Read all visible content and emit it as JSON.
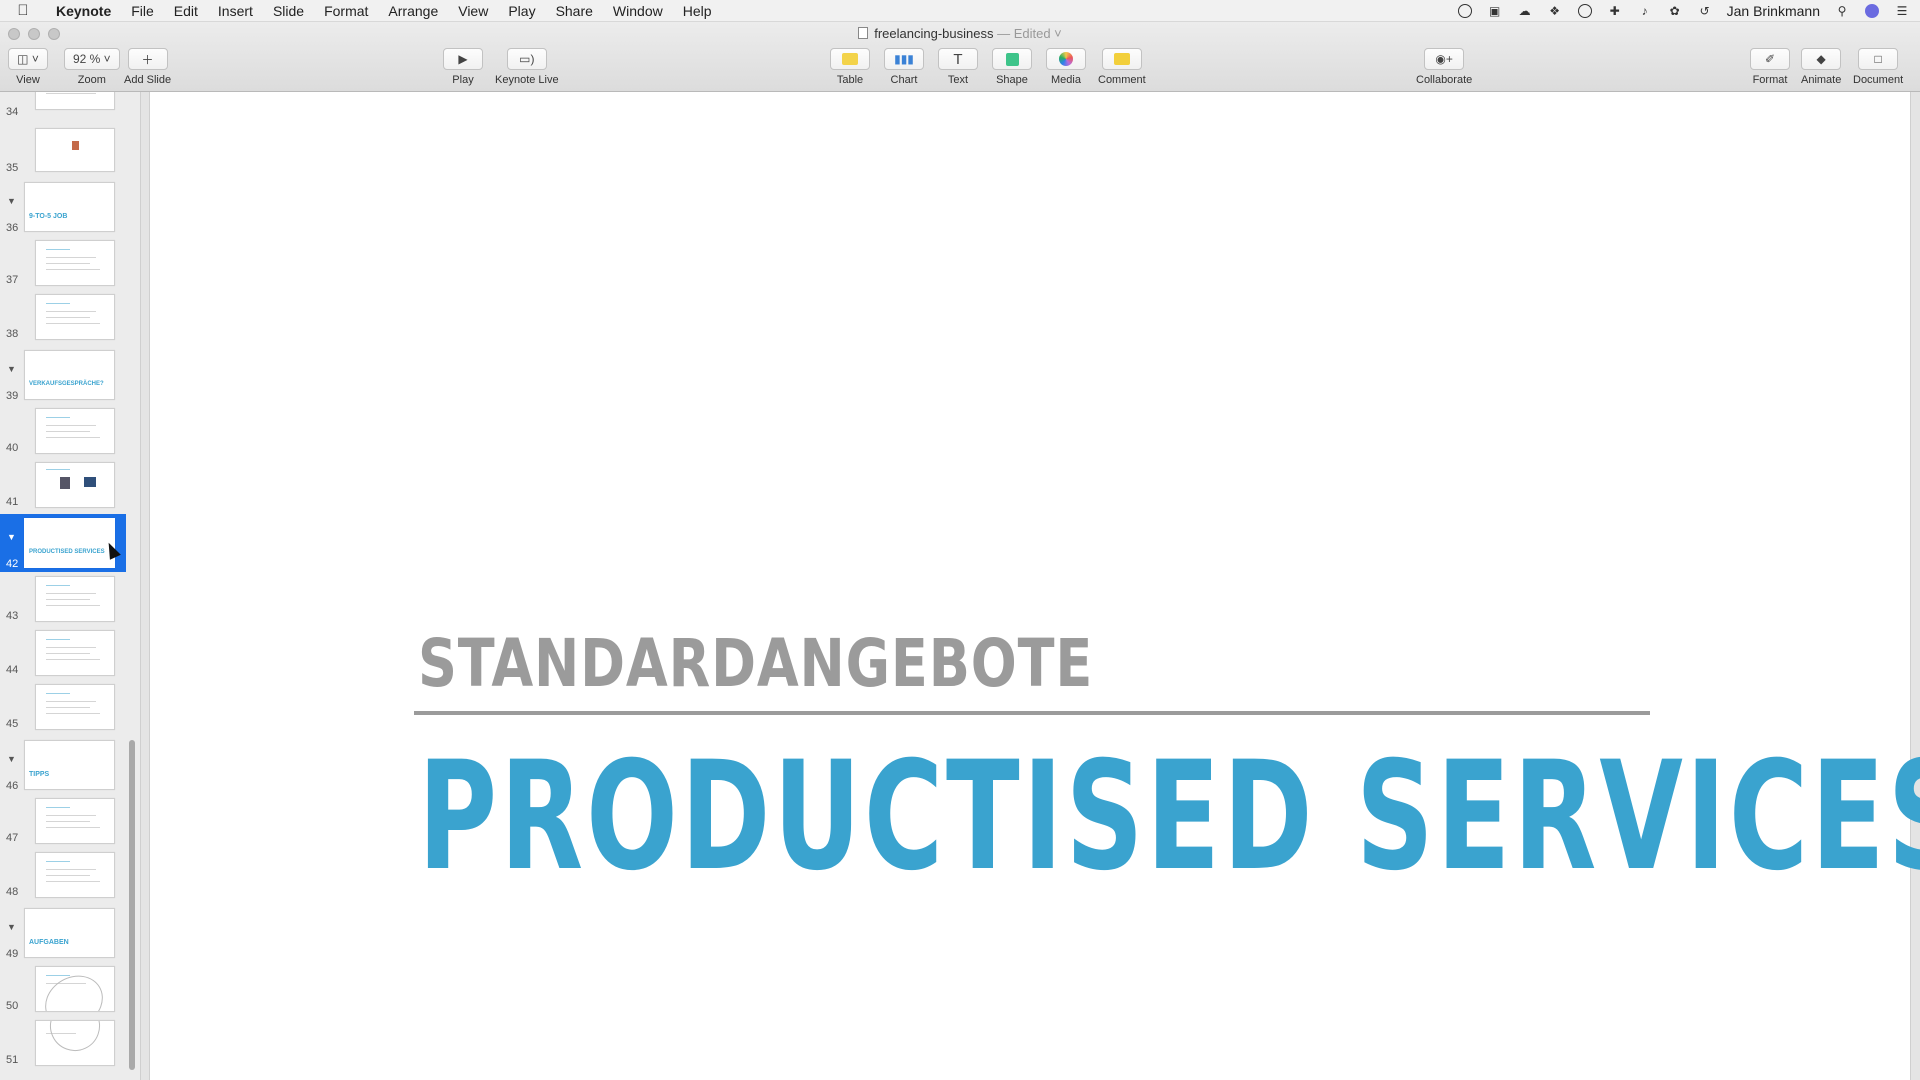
{
  "menubar": {
    "app_name": "Keynote",
    "items": [
      "File",
      "Edit",
      "Insert",
      "Slide",
      "Format",
      "Arrange",
      "View",
      "Play",
      "Share",
      "Window",
      "Help"
    ],
    "user": "Jan Brinkmann"
  },
  "window": {
    "doc_name": "freelancing-business",
    "edited": "— Edited ˅"
  },
  "toolbar": {
    "view_label": "View",
    "zoom_value": "92 % ˅",
    "zoom_label": "Zoom",
    "add_slide_label": "Add Slide",
    "play_label": "Play",
    "keynote_live_label": "Keynote Live",
    "table_label": "Table",
    "chart_label": "Chart",
    "text_label": "Text",
    "shape_label": "Shape",
    "media_label": "Media",
    "comment_label": "Comment",
    "collaborate_label": "Collaborate",
    "format_label": "Format",
    "animate_label": "Animate",
    "document_label": "Document",
    "colors": {
      "table": "#f3d34a",
      "chart": "#3b82d6",
      "shape": "#3ec48a",
      "comment": "#f2cf3b"
    }
  },
  "navigator": {
    "slides": [
      {
        "num": "34"
      },
      {
        "num": "35"
      },
      {
        "num": "36",
        "title": "9-TO-5 JOB"
      },
      {
        "num": "37"
      },
      {
        "num": "38"
      },
      {
        "num": "39",
        "title": "VERKAUFSGESPRÄCHE?"
      },
      {
        "num": "40"
      },
      {
        "num": "41"
      },
      {
        "num": "42",
        "title": "PRODUCTISED SERVICES",
        "selected": true
      },
      {
        "num": "43"
      },
      {
        "num": "44"
      },
      {
        "num": "45"
      },
      {
        "num": "46",
        "title": "TIPPS"
      },
      {
        "num": "47"
      },
      {
        "num": "48"
      },
      {
        "num": "49",
        "title": "AUFGABEN"
      },
      {
        "num": "50"
      },
      {
        "num": "51"
      }
    ]
  },
  "slide": {
    "subtitle": "STANDARDANGEBOTE",
    "title": "PRODUCTISED SERVICES",
    "title_color": "#3aa3cf",
    "subtitle_color": "#9b9b9b"
  }
}
